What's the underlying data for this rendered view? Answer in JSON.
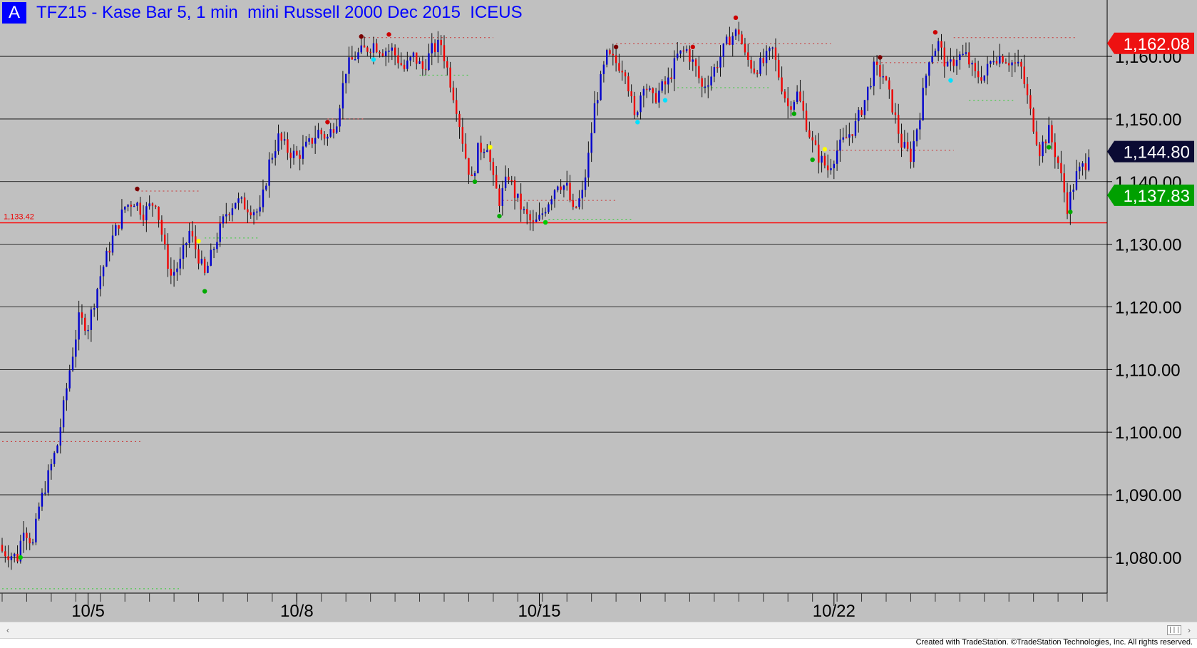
{
  "header": {
    "badge": "A",
    "title": "TFZ15 - Kase Bar 5, 1 min  mini Russell 2000 Dec 2015  ICEUS"
  },
  "footer": {
    "credit": "Created with TradeStation. ©TradeStation Technologies, Inc. All rights reserved."
  },
  "scrollbar": {
    "left_arrow": "‹",
    "right_arrow": "›",
    "thumb_grip": "|||"
  },
  "colors": {
    "background": "#c0c0c0",
    "up_bar": "#0000cc",
    "down_bar": "#ee0000",
    "reference_line": "#ff0000",
    "grid": "#000000"
  },
  "chart_data": {
    "type": "candlestick",
    "symbol": "TFZ15",
    "yaxis": {
      "ticks": [
        1080,
        1090,
        1100,
        1110,
        1120,
        1130,
        1140,
        1150,
        1160
      ],
      "tick_labels": [
        "1,080.00",
        "1,090.00",
        "1,100.00",
        "1,110.00",
        "1,120.00",
        "1,130.00",
        "1,140.00",
        "1,150.00",
        "1,160.00"
      ],
      "ylim": [
        1074.3,
        1169.0
      ],
      "side": "right"
    },
    "xaxis": {
      "labels": [
        "10/5",
        "10/8",
        "10/15",
        "10/22"
      ],
      "label_positions": [
        28,
        96,
        175,
        271
      ],
      "xlim": [
        0,
        360
      ]
    },
    "grid": true,
    "reference_line": {
      "value": 1133.42,
      "label": "1,133.42"
    },
    "price_tags": [
      {
        "text": "1,162.08",
        "value": 1162.08,
        "color": "#ee1111"
      },
      {
        "text": "1,144.80",
        "value": 1144.8,
        "color": "#0a0a33"
      },
      {
        "text": "1,137.83",
        "value": 1137.83,
        "color": "#00a000"
      }
    ],
    "anchors": [
      [
        0,
        1081
      ],
      [
        5,
        1080
      ],
      [
        7,
        1085
      ],
      [
        10,
        1082
      ],
      [
        12,
        1088
      ],
      [
        15,
        1093
      ],
      [
        18,
        1098
      ],
      [
        22,
        1110
      ],
      [
        25,
        1118
      ],
      [
        28,
        1117
      ],
      [
        32,
        1125
      ],
      [
        36,
        1131
      ],
      [
        40,
        1136
      ],
      [
        43,
        1137
      ],
      [
        46,
        1135
      ],
      [
        50,
        1137
      ],
      [
        53,
        1129
      ],
      [
        55,
        1125
      ],
      [
        58,
        1127
      ],
      [
        61,
        1132
      ],
      [
        64,
        1128
      ],
      [
        66,
        1125
      ],
      [
        70,
        1131
      ],
      [
        73,
        1135
      ],
      [
        76,
        1137
      ],
      [
        80,
        1136
      ],
      [
        84,
        1135
      ],
      [
        87,
        1143
      ],
      [
        90,
        1147
      ],
      [
        93,
        1145
      ],
      [
        96,
        1144
      ],
      [
        100,
        1146
      ],
      [
        103,
        1148
      ],
      [
        106,
        1147
      ],
      [
        109,
        1150
      ],
      [
        112,
        1158
      ],
      [
        115,
        1160
      ],
      [
        118,
        1161
      ],
      [
        121,
        1162
      ],
      [
        124,
        1161
      ],
      [
        127,
        1161
      ],
      [
        131,
        1158
      ],
      [
        134,
        1160
      ],
      [
        137,
        1158
      ],
      [
        140,
        1161
      ],
      [
        143,
        1162
      ],
      [
        146,
        1156
      ],
      [
        148,
        1152
      ],
      [
        151,
        1144
      ],
      [
        153,
        1140
      ],
      [
        155,
        1145
      ],
      [
        158,
        1146
      ],
      [
        160,
        1140
      ],
      [
        162,
        1137
      ],
      [
        165,
        1141
      ],
      [
        167,
        1138
      ],
      [
        170,
        1135
      ],
      [
        173,
        1133
      ],
      [
        175,
        1134
      ],
      [
        178,
        1137
      ],
      [
        181,
        1140
      ],
      [
        184,
        1139
      ],
      [
        186,
        1135
      ],
      [
        189,
        1138
      ],
      [
        191,
        1144
      ],
      [
        193,
        1152
      ],
      [
        197,
        1160
      ],
      [
        200,
        1159
      ],
      [
        203,
        1158
      ],
      [
        206,
        1150
      ],
      [
        209,
        1156
      ],
      [
        212,
        1153
      ],
      [
        215,
        1155
      ],
      [
        217,
        1156
      ],
      [
        220,
        1160
      ],
      [
        223,
        1161
      ],
      [
        226,
        1158
      ],
      [
        228,
        1155
      ],
      [
        231,
        1157
      ],
      [
        234,
        1160
      ],
      [
        237,
        1163
      ],
      [
        240,
        1164
      ],
      [
        242,
        1160
      ],
      [
        245,
        1158
      ],
      [
        248,
        1159
      ],
      [
        251,
        1161
      ],
      [
        253,
        1157
      ],
      [
        256,
        1152
      ],
      [
        259,
        1154
      ],
      [
        261,
        1151
      ],
      [
        264,
        1146
      ],
      [
        266,
        1144
      ],
      [
        269,
        1142
      ],
      [
        272,
        1145
      ],
      [
        275,
        1147
      ],
      [
        278,
        1149
      ],
      [
        281,
        1153
      ],
      [
        284,
        1158
      ],
      [
        287,
        1157
      ],
      [
        290,
        1152
      ],
      [
        293,
        1146
      ],
      [
        296,
        1144
      ],
      [
        299,
        1151
      ],
      [
        302,
        1160
      ],
      [
        305,
        1162
      ],
      [
        308,
        1158
      ],
      [
        311,
        1160
      ],
      [
        314,
        1160
      ],
      [
        317,
        1157
      ],
      [
        320,
        1157
      ],
      [
        323,
        1160
      ],
      [
        326,
        1160
      ],
      [
        329,
        1159
      ],
      [
        332,
        1158
      ],
      [
        335,
        1151
      ],
      [
        338,
        1145
      ],
      [
        341,
        1148
      ],
      [
        344,
        1143
      ],
      [
        347,
        1136
      ],
      [
        350,
        1141
      ],
      [
        353,
        1143
      ],
      [
        354,
        1145
      ]
    ]
  }
}
